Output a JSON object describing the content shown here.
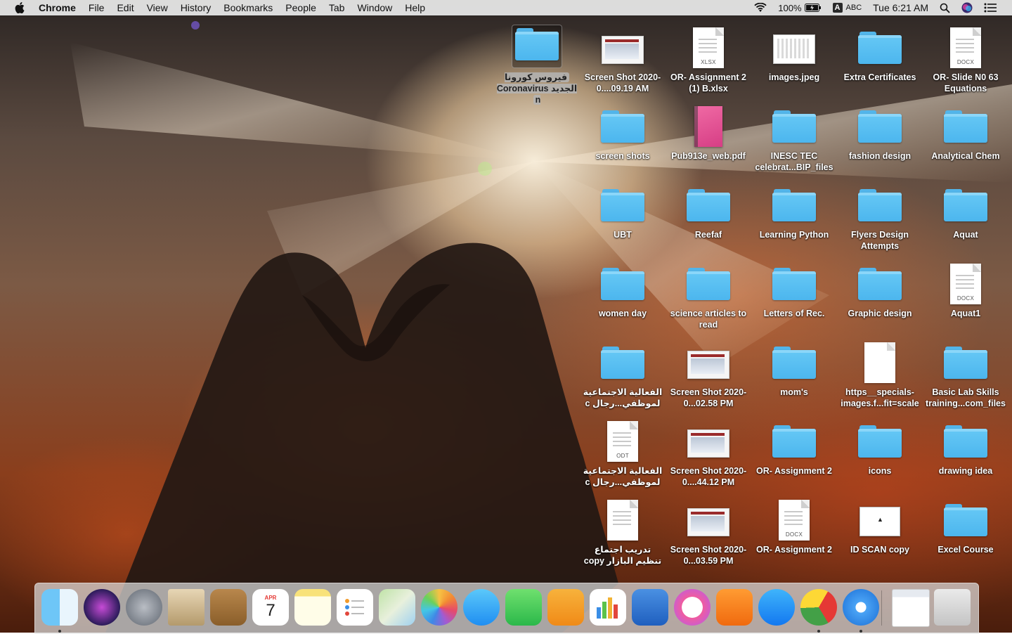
{
  "menubar": {
    "app_name": "Chrome",
    "menus": [
      "File",
      "Edit",
      "View",
      "History",
      "Bookmarks",
      "People",
      "Tab",
      "Window",
      "Help"
    ],
    "battery": "100%",
    "input_badge": "A",
    "input_source": "ABC",
    "clock": "Tue 6:21 AM"
  },
  "desktop_icons": [
    {
      "label": "فيروس كورونا الجديد Coronavirus n",
      "kind": "folder",
      "selected": true
    },
    {
      "label": "Screen Shot 2020-0....09.19 AM",
      "kind": "screenshot"
    },
    {
      "label": "OR- Assignment 2 (1) B.xlsx",
      "kind": "doc",
      "ext": "XLSX"
    },
    {
      "label": "images.jpeg",
      "kind": "image"
    },
    {
      "label": "Extra Certificates",
      "kind": "folder"
    },
    {
      "label": "OR- Slide N0 63 Equations",
      "kind": "doc",
      "ext": "DOCX"
    },
    {
      "label": "screen shots",
      "kind": "folder"
    },
    {
      "label": "Pub913e_web.pdf",
      "kind": "pdf"
    },
    {
      "label": "INESC TEC celebrat...BIP_files",
      "kind": "folder"
    },
    {
      "label": "fashion design",
      "kind": "folder"
    },
    {
      "label": "Analytical Chem",
      "kind": "folder"
    },
    {
      "label": "UBT",
      "kind": "folder"
    },
    {
      "label": "Reefaf",
      "kind": "folder"
    },
    {
      "label": "Learning Python",
      "kind": "folder"
    },
    {
      "label": "Flyers Design Attempts",
      "kind": "folder"
    },
    {
      "label": "Aquat",
      "kind": "folder"
    },
    {
      "label": "women day",
      "kind": "folder"
    },
    {
      "label": "science articles to read",
      "kind": "folder"
    },
    {
      "label": "Letters of Rec.",
      "kind": "folder"
    },
    {
      "label": "Graphic design",
      "kind": "folder"
    },
    {
      "label": "Aquat1",
      "kind": "doc",
      "ext": "DOCX"
    },
    {
      "label": "الفعالية الاجتماعية لموظفي...رجال c",
      "kind": "folder"
    },
    {
      "label": "Screen Shot 2020-0...02.58 PM",
      "kind": "screenshot"
    },
    {
      "label": "mom's",
      "kind": "folder"
    },
    {
      "label": "https__specials-images.f...fit=scale",
      "kind": "blank"
    },
    {
      "label": "Basic Lab Skills training...com_files",
      "kind": "folder"
    },
    {
      "label": "الفعالية الاجتماعية لموظفي...رجال c",
      "kind": "doc",
      "ext": "ODT"
    },
    {
      "label": "Screen Shot 2020-0....44.12 PM",
      "kind": "screenshot"
    },
    {
      "label": "OR- Assignment 2",
      "kind": "folder"
    },
    {
      "label": "icons",
      "kind": "folder"
    },
    {
      "label": "drawing idea",
      "kind": "folder"
    },
    {
      "label": "تدريب اجتماع تنظيم البازار copy",
      "kind": "doc",
      "ext": ""
    },
    {
      "label": "Screen Shot 2020-0...03.59 PM",
      "kind": "screenshot"
    },
    {
      "label": "OR- Assignment 2",
      "kind": "doc",
      "ext": "DOCX"
    },
    {
      "label": "ID SCAN copy",
      "kind": "idscan"
    },
    {
      "label": "Excel Course",
      "kind": "folder"
    }
  ],
  "dock": [
    {
      "name": "Finder",
      "running": true
    },
    {
      "name": "Siri"
    },
    {
      "name": "Launchpad"
    },
    {
      "name": "Mail"
    },
    {
      "name": "Contacts"
    },
    {
      "name": "Calendar",
      "month": "APR",
      "day": "7"
    },
    {
      "name": "Notes"
    },
    {
      "name": "Reminders"
    },
    {
      "name": "Maps"
    },
    {
      "name": "Photos"
    },
    {
      "name": "Messages"
    },
    {
      "name": "FaceTime"
    },
    {
      "name": "Pages"
    },
    {
      "name": "Numbers"
    },
    {
      "name": "Keynote"
    },
    {
      "name": "iTunes"
    },
    {
      "name": "Books"
    },
    {
      "name": "App Store"
    },
    {
      "name": "Google Chrome",
      "running": true
    },
    {
      "name": "Safari",
      "running": true
    },
    {
      "name": "Chrome window"
    },
    {
      "name": "Trash"
    }
  ],
  "colors": {
    "folder": "#4cb6ee",
    "menubar": "#ececec"
  }
}
